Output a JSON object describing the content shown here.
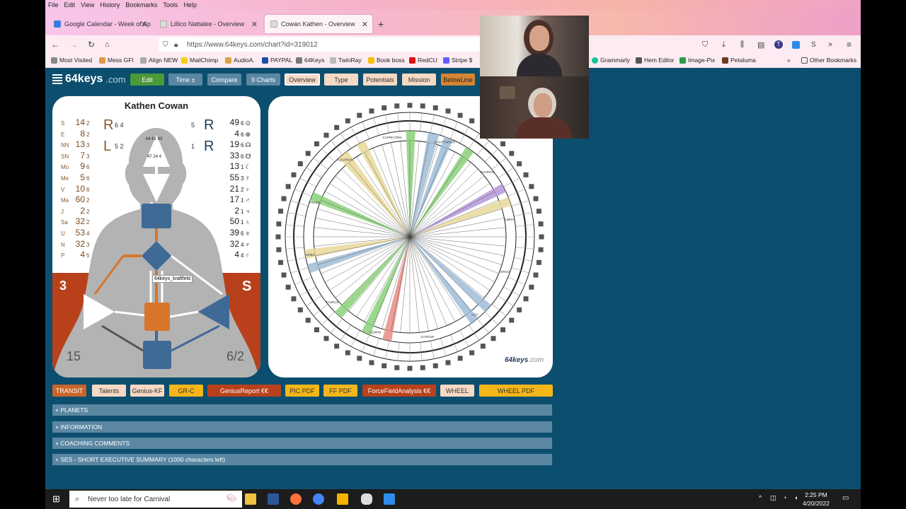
{
  "menu": [
    "File",
    "Edit",
    "View",
    "History",
    "Bookmarks",
    "Tools",
    "Help"
  ],
  "tabs": [
    {
      "label": "Google Calendar - Week of Ap",
      "color": "#3b7be0"
    },
    {
      "label": "Lillico Nattalee - Overview",
      "color": "#e8e8e8"
    },
    {
      "label": "Cowan Kathen - Overview",
      "color": "#e8e8e8"
    }
  ],
  "url": "https://www.64keys.com/chart?id=319012",
  "bookmarks": [
    "Most Visited",
    "Mess GFI",
    "Align NEW",
    "MailChimp",
    "AudioA.",
    "PAYPAL",
    "64Keys",
    "TwinRay",
    "Book boss",
    "RedCU",
    "Stripe $",
    "Grammarly",
    "Hem Editor",
    "Image-Pix",
    "Petaluma",
    "Other Bookmarks"
  ],
  "site": {
    "logo": "64keys",
    "logo_suffix": ".com"
  },
  "top_buttons": [
    "Edit",
    "Time ±",
    "Compare",
    "9 Charts",
    "Overview",
    "Type",
    "Potentials",
    "Mission",
    "BelowLine"
  ],
  "chart": {
    "name": "Kathen Cowan",
    "left_letters": [
      "R",
      "L"
    ],
    "left_codes": [
      "6 4",
      "5 2"
    ],
    "right_letters": [
      "R",
      "R"
    ],
    "right_codes": [
      "5",
      "1"
    ],
    "head_nums": "64 61 63",
    "ajna_nums": "47 24 4",
    "tooltip": "64keys_kraftfeld",
    "profile_left": "3",
    "profile_right": "S",
    "bottom_left": "15",
    "bottom_right": "6/2",
    "design": [
      {
        "sym": "S",
        "n": "14",
        "s": "2"
      },
      {
        "sym": "E",
        "n": "8",
        "s": "2"
      },
      {
        "sym": "NN",
        "n": "13",
        "s": "3"
      },
      {
        "sym": "SN",
        "n": "7",
        "s": "3"
      },
      {
        "sym": "Mo",
        "n": "9",
        "s": "6"
      },
      {
        "sym": "Me",
        "n": "5",
        "s": "6"
      },
      {
        "sym": "V",
        "n": "10",
        "s": "6"
      },
      {
        "sym": "Ma",
        "n": "60",
        "s": "2"
      },
      {
        "sym": "J",
        "n": "2",
        "s": "2"
      },
      {
        "sym": "Sa",
        "n": "32",
        "s": "2"
      },
      {
        "sym": "U",
        "n": "53",
        "s": "4"
      },
      {
        "sym": "N",
        "n": "32",
        "s": "3"
      },
      {
        "sym": "P",
        "n": "4",
        "s": "5"
      }
    ],
    "personality": [
      {
        "n": "49",
        "s": "6",
        "p": "⊙"
      },
      {
        "n": "4",
        "s": "6",
        "p": "⊕"
      },
      {
        "n": "19",
        "s": "6",
        "p": "☊"
      },
      {
        "n": "33",
        "s": "6",
        "p": "☋"
      },
      {
        "n": "13",
        "s": "1",
        "p": "☾"
      },
      {
        "n": "55",
        "s": "3",
        "p": "☿"
      },
      {
        "n": "21",
        "s": "2",
        "p": "♀"
      },
      {
        "n": "17",
        "s": "1",
        "p": "♂"
      },
      {
        "n": "2",
        "s": "1",
        "p": "♃"
      },
      {
        "n": "50",
        "s": "1",
        "p": "♄"
      },
      {
        "n": "39",
        "s": "6",
        "p": "♅"
      },
      {
        "n": "32",
        "s": "4",
        "p": "♆"
      },
      {
        "n": "4",
        "s": "4",
        "p": "♇"
      }
    ]
  },
  "wheel": {
    "signs": [
      "CAPRICORN",
      "SAGITTARIUS",
      "SCORPIO",
      "LIBRA",
      "VIRGO",
      "LEO",
      "CANCER",
      "GEMINI",
      "TAURUS",
      "ARIES",
      "PISCES",
      "AQUARIUS"
    ],
    "watermark": "64keys",
    "watermark_suffix": ".com"
  },
  "bottom_buttons": [
    {
      "label": "TRANSIT",
      "bg": "#c8652a",
      "fg": "#ffffff"
    },
    {
      "label": "Talents",
      "bg": "#f5d9c4",
      "fg": "#333333"
    },
    {
      "label": "Genius-KF",
      "bg": "#f5d9c4",
      "fg": "#333333"
    },
    {
      "label": "GR-C",
      "bg": "#f5b619",
      "fg": "#333333"
    },
    {
      "label": "GeniusReport €€",
      "bg": "#b8411c",
      "fg": "#ffffff"
    },
    {
      "label": "PIC PDF",
      "bg": "#f5b619",
      "fg": "#333333"
    },
    {
      "label": "FF PDF",
      "bg": "#f5b619",
      "fg": "#333333"
    },
    {
      "label": "ForceFieldAnalysis €€",
      "bg": "#b8411c",
      "fg": "#ffffff"
    },
    {
      "label": "WHEEL",
      "bg": "#f5d9c4",
      "fg": "#333333"
    },
    {
      "label": "WHEEL PDF",
      "bg": "#f5b619",
      "fg": "#333333"
    }
  ],
  "sections": [
    "+ PLANETS",
    "+ INFORMATION",
    "+ COACHING COMMENTS",
    "+ SES - SHORT EXECUTIVE SUMMARY (1000 characters left)"
  ],
  "taskbar": {
    "search_placeholder": "Never too late for Carnival",
    "time": "2:25 PM",
    "date": "4/20/2022"
  }
}
